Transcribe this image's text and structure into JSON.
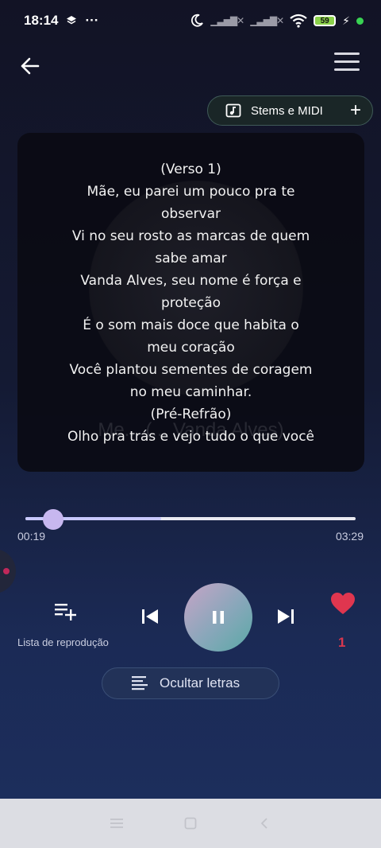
{
  "status": {
    "time": "18:14",
    "battery": "59"
  },
  "stems_button": {
    "label": "Stems e MIDI"
  },
  "lyrics": {
    "background_title": "Me... (... Vanda Alves)",
    "lines": [
      "(Verso 1)",
      "Mãe, eu parei um pouco pra te",
      "observar",
      "Vi no seu rosto as marcas de quem",
      "sabe amar",
      "Vanda Alves, seu nome é força e",
      "proteção",
      "É o som mais doce que habita o",
      "meu coração",
      "Você plantou sementes de coragem",
      "no meu caminhar.",
      "(Pré-Refrão)",
      "Olho pra trás e vejo tudo o que você"
    ]
  },
  "player": {
    "elapsed": "00:19",
    "duration": "03:29",
    "progress": 0.41,
    "queue_label": "Lista de reprodução",
    "like_count": "1",
    "hide_lyrics_label": "Ocultar letras",
    "state": "playing"
  },
  "colors": {
    "accent_heart": "#d9374e",
    "play_gradient_start": "#c7a4c7",
    "play_gradient_end": "#5aa9a6"
  }
}
